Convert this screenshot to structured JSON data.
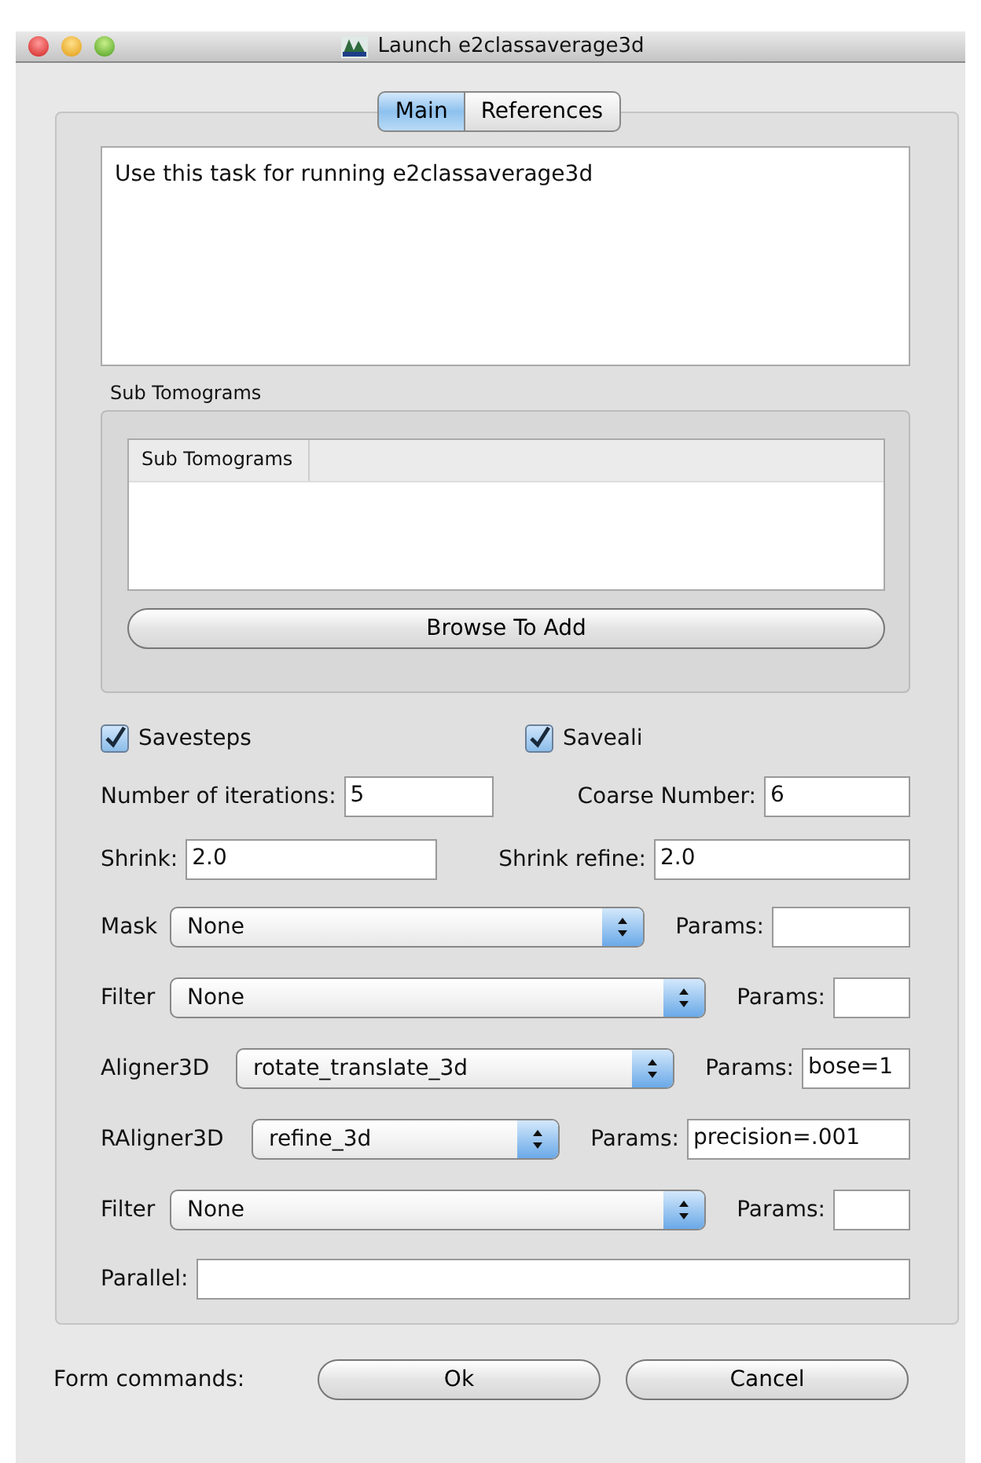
{
  "window": {
    "title": "Launch e2classaverage3d"
  },
  "tabs": [
    {
      "label": "Main",
      "selected": true
    },
    {
      "label": "References",
      "selected": false
    }
  ],
  "description": "Use this task for running e2classaverage3d",
  "group": {
    "title": "Sub Tomograms",
    "list_header": "Sub Tomograms",
    "button": "Browse To Add"
  },
  "rows": [
    {
      "kind": "checks",
      "items": [
        {
          "label": "Savesteps",
          "checked": true
        },
        {
          "label": "Saveali",
          "checked": true
        }
      ]
    },
    {
      "kind": "inputs",
      "items": [
        {
          "label": "Number of iterations:",
          "value": "5"
        },
        {
          "label": "Coarse Number:",
          "value": "6"
        }
      ]
    },
    {
      "kind": "inputs",
      "items": [
        {
          "label": "Shrink:",
          "value": "2.0"
        },
        {
          "label": "Shrink refine:",
          "value": "2.0"
        }
      ]
    },
    {
      "kind": "select",
      "label": "Mask",
      "value": "None",
      "params_label": "Params:"
    },
    {
      "kind": "select",
      "label": "Filter",
      "value": "None",
      "params_label": "Params:"
    },
    {
      "kind": "select",
      "label": "Aligner3D",
      "value": "rotate_translate_3d",
      "params_label": "Params:",
      "params_value": "bose=1"
    },
    {
      "kind": "select",
      "label": "RAligner3D",
      "value": "refine_3d",
      "params_label": "Params:",
      "params_value": "precision=.001"
    },
    {
      "kind": "select",
      "label": "Filter",
      "value": "None",
      "params_label": "Params:"
    },
    {
      "kind": "wide",
      "label": "Parallel:"
    }
  ],
  "footer": {
    "label": "Form commands:",
    "buttons": [
      "Ok",
      "Cancel"
    ]
  }
}
